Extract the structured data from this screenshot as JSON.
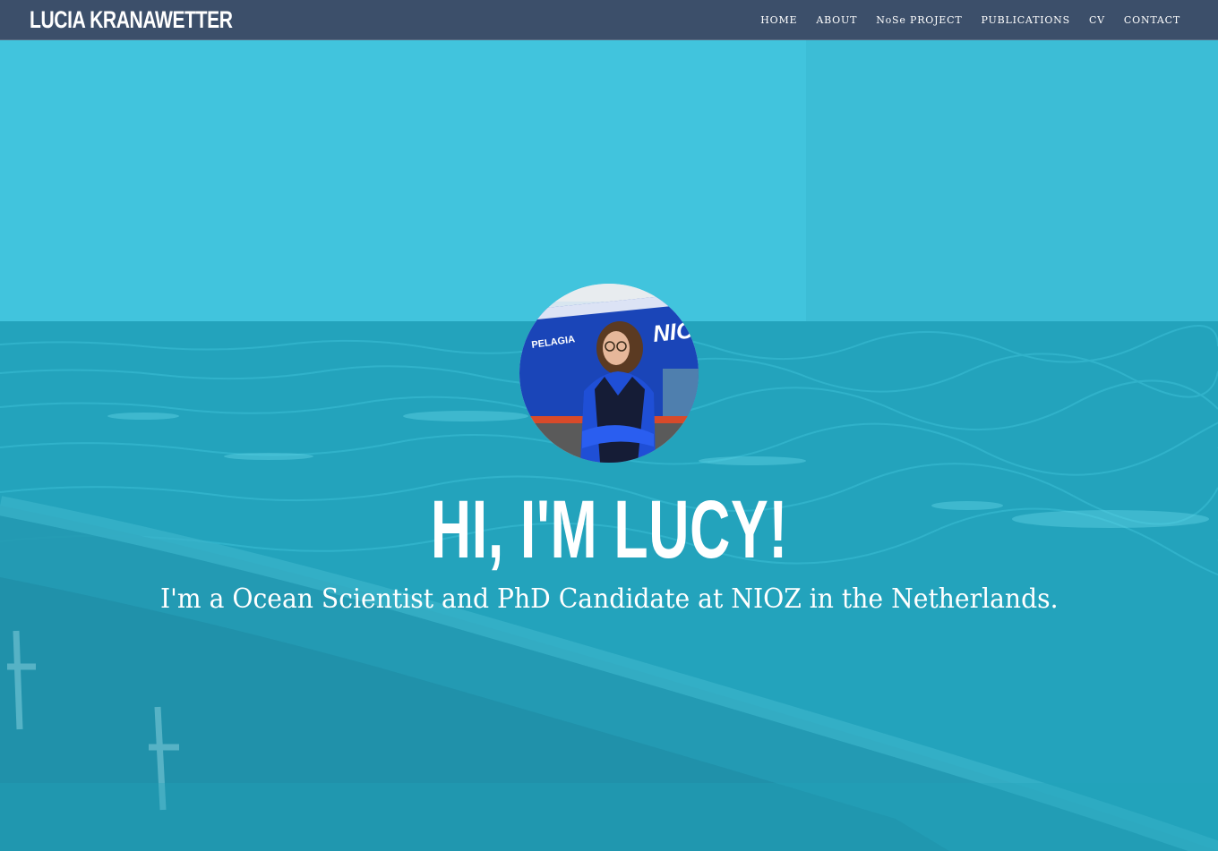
{
  "navbar": {
    "brand": "LUCIA KRANAWETTER",
    "links": [
      {
        "label": "HOME"
      },
      {
        "label": "ABOUT"
      },
      {
        "label": "NoSe PROJECT"
      },
      {
        "label": "PUBLICATIONS"
      },
      {
        "label": "CV"
      },
      {
        "label": "CONTACT"
      }
    ]
  },
  "hero": {
    "headline": "HI, I'M LUCY!",
    "subheadline": "I'm a Ocean Scientist and PhD Candidate at NIOZ in the Netherlands.",
    "avatar": {
      "ship_name": "PELAGIA",
      "ship_hull_text": "NIO"
    }
  },
  "colors": {
    "navbar_bg": "#3c4f6a",
    "hero_tint": "#2bb3ca",
    "text": "#ffffff"
  }
}
